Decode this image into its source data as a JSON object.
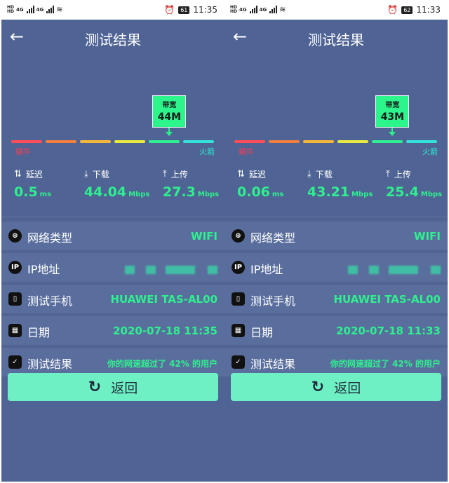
{
  "screens": [
    {
      "status": {
        "net_hd": "HD",
        "signal_a": "4G",
        "signal_b": "4G",
        "battery": "61",
        "time": "11:35"
      },
      "app": {
        "title": "测试结果"
      },
      "meter": {
        "bandwidth_label": "带宽",
        "bandwidth_value": "44M",
        "level": 0.78,
        "slow_label": "蜗牛",
        "fast_label": "火箭"
      },
      "stats": {
        "latency": {
          "label": "延迟",
          "value": "0.5",
          "unit": "ms"
        },
        "download": {
          "label": "下载",
          "value": "44.04",
          "unit": "Mbps"
        },
        "upload": {
          "label": "上传",
          "value": "27.3",
          "unit": "Mbps"
        }
      },
      "rows": [
        {
          "icon": "globe-icon",
          "label": "网络类型",
          "value": "WIFI"
        },
        {
          "icon": "ip-icon",
          "label": "IP地址",
          "value": ""
        },
        {
          "icon": "phone-icon",
          "label": "测试手机",
          "value": "HUAWEI TAS-AL00"
        },
        {
          "icon": "calendar-icon",
          "label": "日期",
          "value": "2020-07-18 11:35"
        },
        {
          "icon": "chart-icon",
          "label": "测试结果",
          "value": "你的网速超过了 42% 的用户"
        }
      ],
      "button": {
        "label": "返回"
      }
    },
    {
      "status": {
        "net_hd": "HD",
        "signal_a": "4G",
        "signal_b": "4G",
        "battery": "62",
        "time": "11:33"
      },
      "app": {
        "title": "测试结果"
      },
      "meter": {
        "bandwidth_label": "带宽",
        "bandwidth_value": "43M",
        "level": 0.78,
        "slow_label": "蜗牛",
        "fast_label": "火箭"
      },
      "stats": {
        "latency": {
          "label": "延迟",
          "value": "0.06",
          "unit": "ms"
        },
        "download": {
          "label": "下载",
          "value": "43.21",
          "unit": "Mbps"
        },
        "upload": {
          "label": "上传",
          "value": "25.4",
          "unit": "Mbps"
        }
      },
      "rows": [
        {
          "icon": "globe-icon",
          "label": "网络类型",
          "value": "WIFI"
        },
        {
          "icon": "ip-icon",
          "label": "IP地址",
          "value": ""
        },
        {
          "icon": "phone-icon",
          "label": "测试手机",
          "value": "HUAWEI TAS-AL00"
        },
        {
          "icon": "calendar-icon",
          "label": "日期",
          "value": "2020-07-18 11:33"
        },
        {
          "icon": "chart-icon",
          "label": "测试结果",
          "value": "你的网速超过了 42% 的用户"
        }
      ],
      "button": {
        "label": "返回"
      }
    }
  ],
  "colors": {
    "background": "#4f6494",
    "accent_green": "#2ef08e",
    "button": "#6ff0c4",
    "meter_segments": [
      "#ff4d57",
      "#f5803e",
      "#f5b73b",
      "#e9ea3f",
      "#2ef08e",
      "#36e2d8"
    ]
  }
}
